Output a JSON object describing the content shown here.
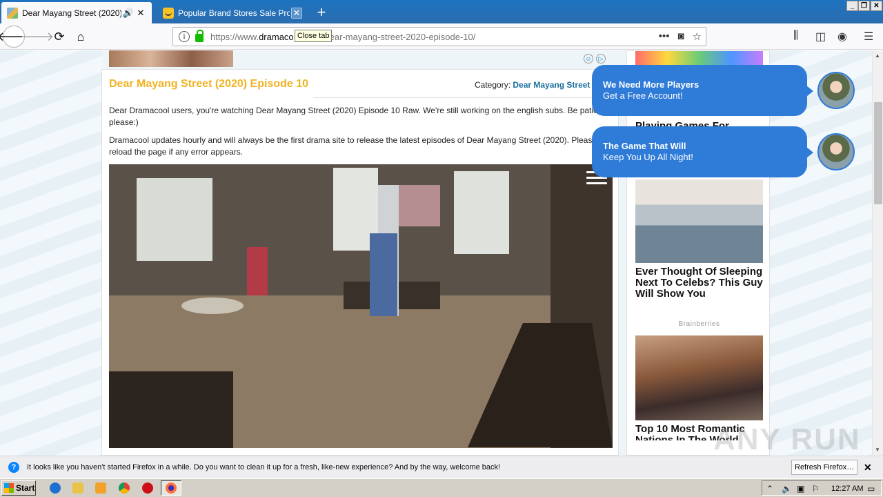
{
  "browser": {
    "tabs": [
      {
        "title": "Dear Mayang Street (2020) Ep",
        "active": true
      },
      {
        "title": "Popular Brand Stores Sale Promoti",
        "active": false
      }
    ],
    "tooltip": "Close tab",
    "url_prefix": "https://www.",
    "url_domain": "dramaco",
    "url_rest": "ear-mayang-street-2020-episode-10/",
    "page_actions": [
      "more-icon",
      "pocket-icon",
      "bookmark-star-icon"
    ]
  },
  "page": {
    "episode_title": "Dear Mayang Street (2020) Episode 10",
    "category_label": "Category:",
    "category_link": "Dear Mayang Street (",
    "paragraph1": "Dear Dramacool users, you're watching Dear Mayang Street (2020) Episode 10 Raw. We're still working on the english subs. Be patient please:)",
    "paragraph2": "Dramacool updates hourly and will always be the first drama site to release the latest episodes of Dear Mayang Street (2020). Please reload the page if any error appears."
  },
  "chat_bubbles": [
    {
      "line1": "We Need More Players",
      "line2": "Get a Free Account!"
    },
    {
      "line1": "The Game That Will",
      "line2": "Keep You Up All Night!"
    }
  ],
  "sidebar": {
    "partial_heading": "Playing Games For",
    "ad1_caption": "Ever Thought Of Sleeping Next To Celebs? This Guy Will Show You",
    "ad_source": "Brainberries",
    "ad2_caption": "Top 10 Most Romantic Nations In The World"
  },
  "notification": {
    "message": "It looks like you haven't started Firefox in a while. Do you want to clean it up for a fresh, like-new experience? And by the way, welcome back!",
    "button": "Refresh Firefox…"
  },
  "taskbar": {
    "start": "Start",
    "clock": "12:27 AM"
  },
  "watermark": "ANY RUN",
  "colors": {
    "title_yellow": "#f0b323",
    "link_blue": "#1a6e9c",
    "bubble_blue": "#2f7bd8"
  }
}
